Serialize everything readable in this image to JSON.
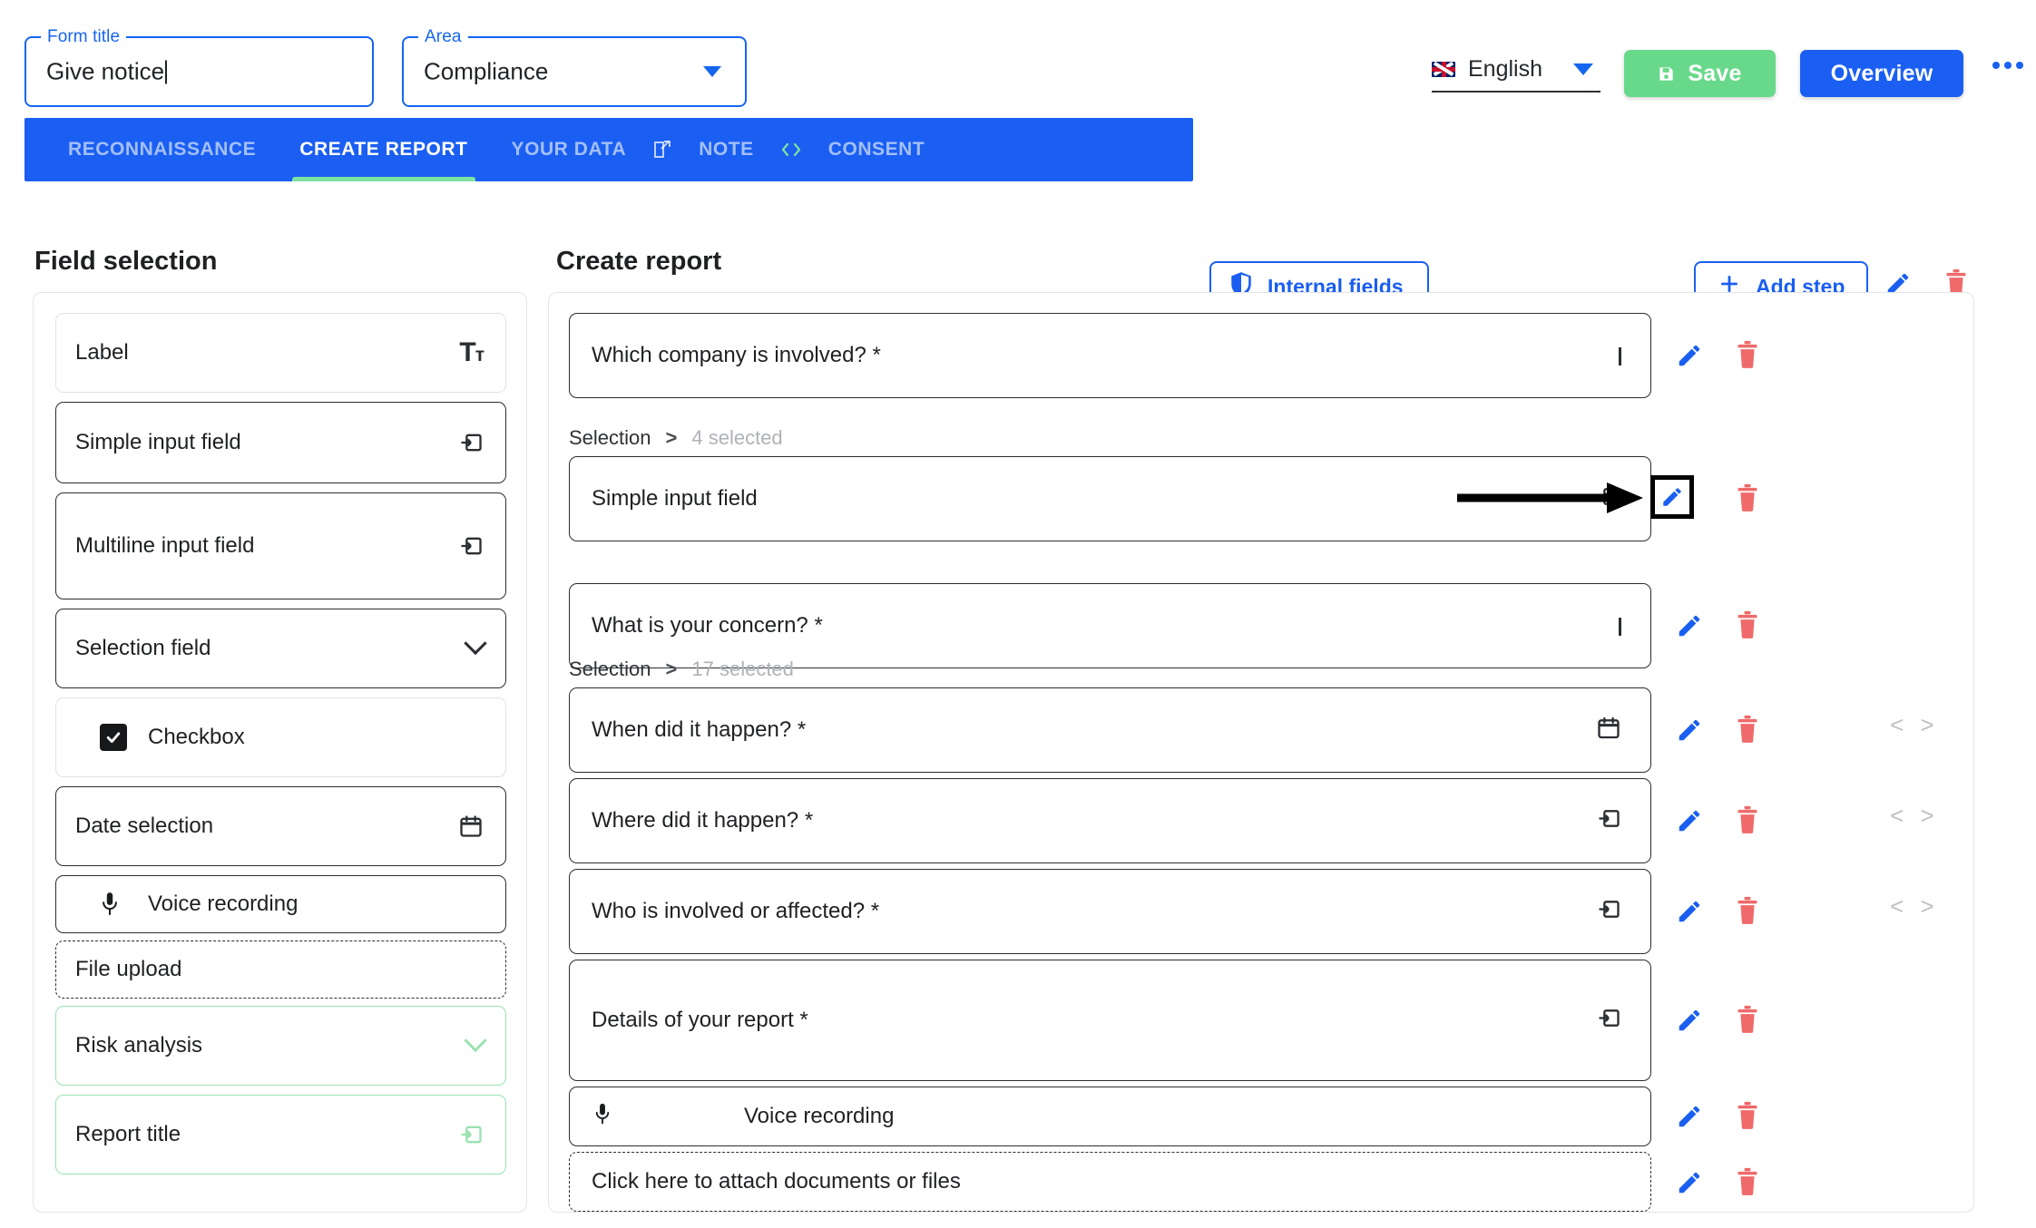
{
  "topbar": {
    "form_title": {
      "legend": "Form title",
      "value": "Give notice"
    },
    "area": {
      "legend": "Area",
      "value": "Compliance"
    },
    "language": {
      "label": "English",
      "flag": "uk-flag-icon"
    },
    "save_label": "Save",
    "overview_label": "Overview",
    "more_icon": "more-horizontal-icon",
    "save_icon": "save-disk-icon"
  },
  "tabs": {
    "items": [
      {
        "label": "RECONNAISSANCE",
        "active": false
      },
      {
        "label": "CREATE REPORT",
        "active": true
      },
      {
        "label": "YOUR DATA",
        "active": false
      },
      {
        "label": "NOTE",
        "active": false
      },
      {
        "label": "CONSENT",
        "active": false
      }
    ],
    "external_link_icon": "external-link-icon",
    "code_icon": "code-brackets-icon",
    "internal_fields_label": "Internal fields",
    "internal_fields_icon": "shield-icon",
    "add_step_label": "Add step",
    "add_step_icon": "plus-icon",
    "edit_icon": "pencil-icon",
    "delete_icon": "trash-icon"
  },
  "field_selection": {
    "heading": "Field selection",
    "items": [
      {
        "label": "Label",
        "icon": "text-size-icon",
        "style": "light"
      },
      {
        "label": "Simple input field",
        "icon": "input-field-icon",
        "style": "solid"
      },
      {
        "label": "Multiline input field",
        "icon": "input-field-icon",
        "style": "solid"
      },
      {
        "label": "Selection field",
        "icon": "chevron-down-icon",
        "style": "solid"
      },
      {
        "label": "Checkbox",
        "icon": "checkbox-checked-icon",
        "style": "light"
      },
      {
        "label": "Date selection",
        "icon": "calendar-icon",
        "style": "solid"
      },
      {
        "label": "Voice recording",
        "icon": "microphone-icon",
        "style": "solid"
      },
      {
        "label": "File upload",
        "icon": "none",
        "style": "dashed"
      },
      {
        "label": "Risk analysis",
        "icon": "chevron-down-icon",
        "style": "green"
      },
      {
        "label": "Report title",
        "icon": "input-field-icon",
        "style": "green"
      }
    ]
  },
  "create_report": {
    "heading": "Create report",
    "rows": [
      {
        "label": "Which company is involved? *",
        "icon": "chevron-down-icon",
        "style": "solid",
        "code": false
      },
      {
        "label": "Simple input field",
        "icon": "input-field-icon",
        "style": "solid",
        "code": false
      },
      {
        "label": "What is your concern? *",
        "icon": "chevron-down-icon",
        "style": "solid",
        "code": false
      },
      {
        "label": "When did it happen? *",
        "icon": "calendar-icon",
        "style": "solid",
        "code": true
      },
      {
        "label": "Where did it happen? *",
        "icon": "input-field-icon",
        "style": "solid",
        "code": true
      },
      {
        "label": "Who is involved or affected? *",
        "icon": "input-field-icon",
        "style": "solid",
        "code": true
      },
      {
        "label": "Details of your report *",
        "icon": "input-field-icon",
        "style": "solid",
        "code": false
      },
      {
        "label": "Voice recording",
        "icon": "microphone-icon",
        "style": "solid",
        "code": false
      },
      {
        "label": "Click here to attach documents or files",
        "icon": "none",
        "style": "dashed",
        "code": false
      }
    ],
    "selection_infos": [
      {
        "key": "Selection",
        "separator": ">",
        "value": "4 selected"
      },
      {
        "key": "Selection",
        "separator": ">",
        "value": "17 selected"
      }
    ],
    "row_edit_icon": "pencil-icon",
    "row_delete_icon": "trash-icon",
    "row_code_icon": "code-brackets-icon"
  },
  "annotation": {
    "arrow_icon": "annotation-arrow-right",
    "highlight_target": "row-edit-pencil-button"
  },
  "colors": {
    "primary_blue": "#1a5ff2",
    "accent_green": "#68d98a",
    "danger_red": "#ef6a6a",
    "muted_gray": "#aeb2b7"
  }
}
